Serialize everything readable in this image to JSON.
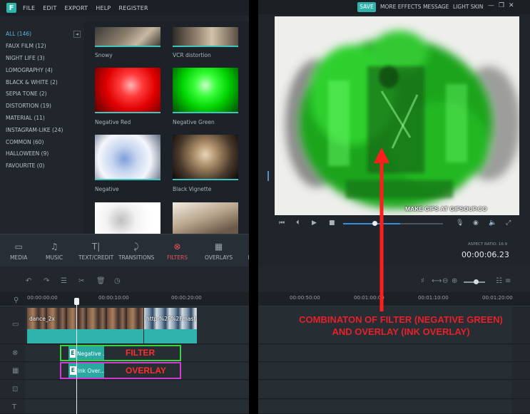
{
  "menubar": {
    "logo_letter": "F",
    "items": [
      "FILE",
      "EDIT",
      "EXPORT",
      "HELP",
      "REGISTER"
    ]
  },
  "categories": [
    {
      "label": "ALL (146)",
      "active": true
    },
    {
      "label": "FAUX FILM (12)"
    },
    {
      "label": "NIGHT LIFE (3)"
    },
    {
      "label": "LOMOGRAPHY (4)"
    },
    {
      "label": "BLACK & WHITE (2)"
    },
    {
      "label": "SEPIA TONE (2)"
    },
    {
      "label": "DISTORTION (19)"
    },
    {
      "label": "MATERIAL (11)"
    },
    {
      "label": "INSTAGRAM-LIKE (24)"
    },
    {
      "label": "COMMON (60)"
    },
    {
      "label": "HALLOWEEN (9)"
    },
    {
      "label": "FAVOURITE (0)"
    }
  ],
  "collapse_icon": "arrow-left-icon",
  "filters": [
    {
      "label": "Snowy"
    },
    {
      "label": "VCR distortion"
    },
    {
      "label": "Negative Red"
    },
    {
      "label": "Negative Green"
    },
    {
      "label": "Negative"
    },
    {
      "label": "Black Vignette"
    },
    {
      "label": ""
    },
    {
      "label": ""
    }
  ],
  "tabs": [
    {
      "label": "MEDIA",
      "icon": "folder-icon"
    },
    {
      "label": "MUSIC",
      "icon": "music-note-icon"
    },
    {
      "label": "TEXT/CREDIT",
      "icon": "text-icon"
    },
    {
      "label": "TRANSITIONS",
      "icon": "transition-icon"
    },
    {
      "label": "FILTERS",
      "icon": "filters-icon",
      "active": true
    },
    {
      "label": "OVERLAYS",
      "icon": "overlay-icon"
    },
    {
      "label": "E",
      "icon": "elements-icon"
    }
  ],
  "preview_header": {
    "save": "SAVE",
    "more_effects": "MORE EFFECTS",
    "message": "MESSAGE",
    "skin": "LIGHT SKIN",
    "minimize": "—",
    "restore": "❐",
    "close": "✕"
  },
  "preview": {
    "watermark": "MAKE GIFS AT GIFSOUP.CO",
    "progress": 0.3
  },
  "aspect_ratio": "ASPECT RATIO: 16:9",
  "timecode": "00:00:06.23",
  "ruler": [
    "00:00:00:00",
    "00:00:10:00",
    "00:00:20:00",
    "00:00:50:00",
    "00:01:00:00",
    "00:01:10:00",
    "00:01:20:00"
  ],
  "clips": {
    "video1": "dance_2x",
    "video2": "http-%2F%2Fmash"
  },
  "fx": {
    "filter_clip": "Negative ...",
    "filter_badge": "E",
    "overlay_clip": "Ink Over...",
    "overlay_badge": "E",
    "filter_annot": "FILTER",
    "overlay_annot": "OVERLAY"
  },
  "annotation": "COMBINATON OF FILTER (NEGATIVE GREEN) AND OVERLAY (INK OVERLAY)",
  "colors": {
    "accent": "#2fb2aa",
    "active_tab": "#e8555f",
    "annotation": "#e8202a",
    "filter_box": "#37d43c",
    "overlay_box": "#d23ad6"
  }
}
